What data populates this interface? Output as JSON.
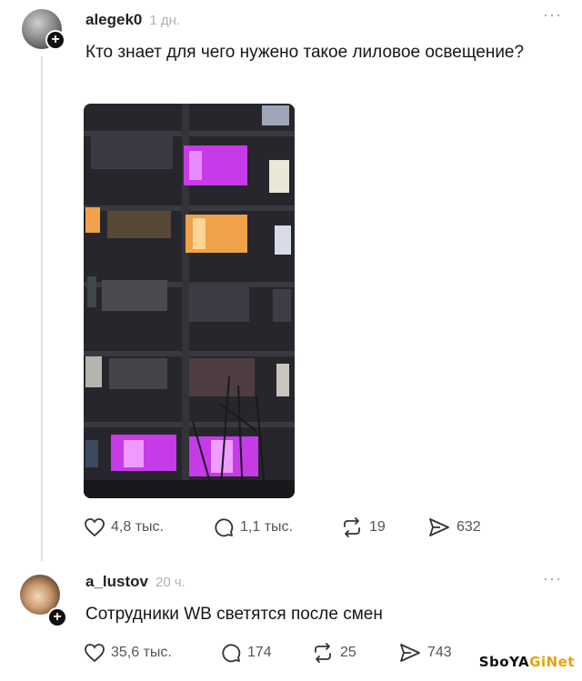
{
  "posts": [
    {
      "username": "alegek0",
      "time": "1 дн.",
      "text": "Кто знает для чего нужено такое лиловое освещение?",
      "more": "···",
      "image": "photo-apartment-building-purple-windows",
      "likes": "4,8 тыс.",
      "replies": "1,1 тыс.",
      "reposts": "19",
      "shares": "632"
    },
    {
      "username": "a_lustov",
      "time": "20 ч.",
      "text": "Сотрудники WB светятся после смен",
      "more": "···",
      "likes": "35,6 тыс.",
      "replies": "174",
      "reposts": "25",
      "shares": "743"
    }
  ],
  "watermark": {
    "part1": "SboYA",
    "part2": "GiNet"
  },
  "icons": {
    "like": "heart-icon",
    "reply": "comment-bubble-icon",
    "repost": "repost-arrows-icon",
    "share": "paper-plane-icon",
    "follow": "plus-icon",
    "more": "more-dots-icon"
  },
  "colors": {
    "purple_window": "#c63ae8",
    "warm_window": "#f0a24a",
    "building": "#2b2a30",
    "thread_line": "#e3e3e3"
  }
}
